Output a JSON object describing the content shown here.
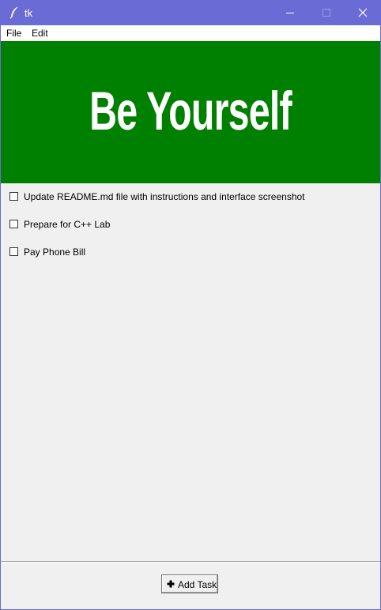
{
  "window": {
    "title": "tk",
    "titlebar_color": "#6b6bd6"
  },
  "menu": {
    "items": [
      {
        "label": "File"
      },
      {
        "label": "Edit"
      }
    ]
  },
  "banner": {
    "text": "Be Yourself",
    "background": "#008000",
    "text_color": "#ffffff"
  },
  "tasks": [
    {
      "label": "Update README.md file with instructions and interface screenshot",
      "checked": false
    },
    {
      "label": "Prepare for C++ Lab",
      "checked": false
    },
    {
      "label": "Pay Phone Bill",
      "checked": false
    }
  ],
  "footer": {
    "add_button_label": "Add Task",
    "add_button_icon": "plus-icon"
  }
}
